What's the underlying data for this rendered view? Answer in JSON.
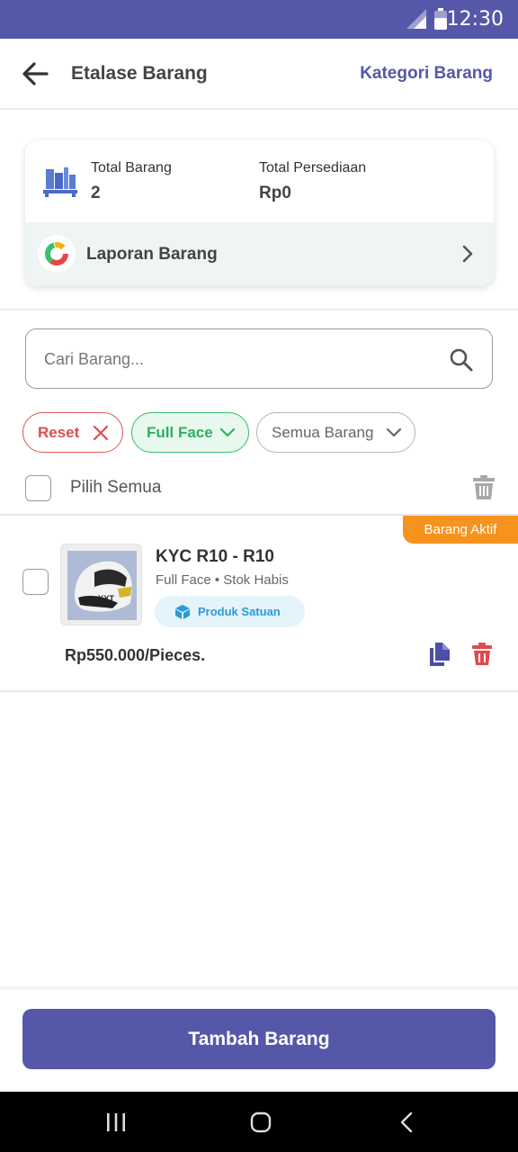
{
  "status_bar": {
    "time": "12:30"
  },
  "app_bar": {
    "title": "Etalase Barang",
    "kategori_link": "Kategori Barang"
  },
  "summary": {
    "total_barang_label": "Total Barang",
    "total_barang_value": "2",
    "total_persediaan_label": "Total Persediaan",
    "total_persediaan_value": "Rp0",
    "report_label": "Laporan Barang"
  },
  "search": {
    "placeholder": "Cari Barang...",
    "value": ""
  },
  "filters": {
    "reset_label": "Reset",
    "category_label": "Full Face",
    "status_label": "Semua Barang"
  },
  "select_all": {
    "label": "Pilih Semua",
    "checked": false
  },
  "products": [
    {
      "name": "KYC R10 - R10",
      "category": "Full Face",
      "stock_status": "Stok Habis",
      "type_label": "Produk Satuan",
      "price": "Rp550.000/Pieces.",
      "badge": "Barang Aktif",
      "thumb_text": "KYT"
    }
  ],
  "add_button": {
    "label": "Tambah Barang"
  },
  "colors": {
    "primary": "#5558a8",
    "accent_orange": "#f6921e",
    "danger": "#e05a5a",
    "success": "#3cbf6d",
    "info": "#2a9bd6"
  },
  "icons": {
    "back": "arrow-left-icon",
    "inventory": "shelf-boxes-icon",
    "report": "pie-chart-icon",
    "search": "search-icon",
    "trash": "trash-icon",
    "copy": "copy-icon",
    "box": "box-icon"
  }
}
